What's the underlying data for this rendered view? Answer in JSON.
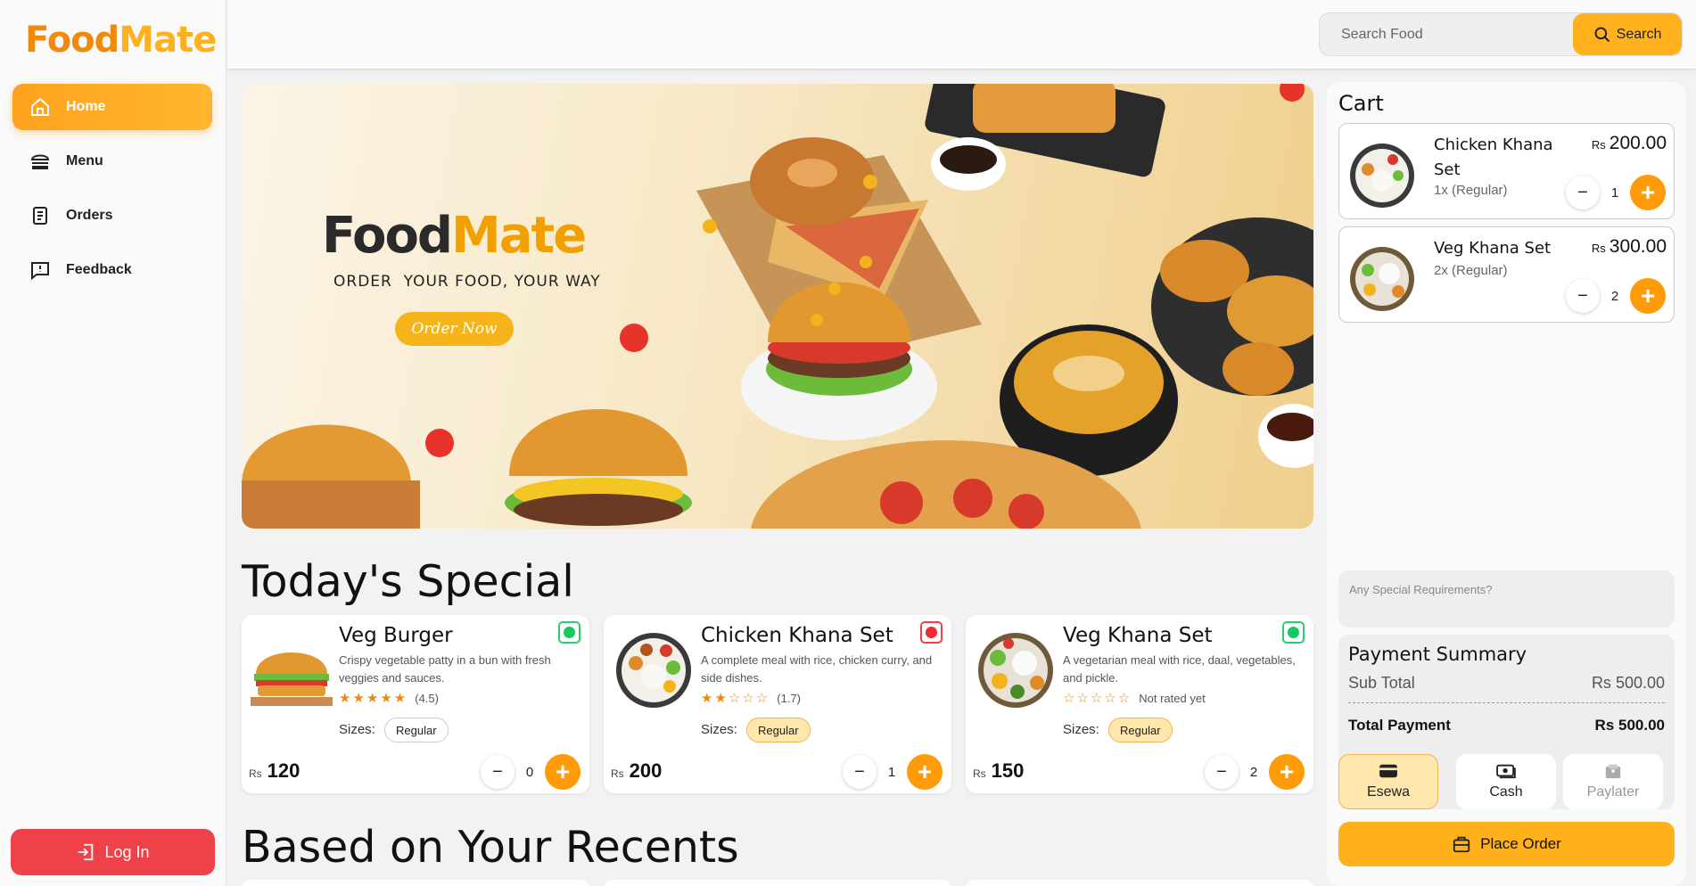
{
  "brand": {
    "part1": "Food",
    "part2": "Mate"
  },
  "nav": [
    {
      "label": "Home",
      "icon": "home-icon",
      "active": true
    },
    {
      "label": "Menu",
      "icon": "burger-icon"
    },
    {
      "label": "Orders",
      "icon": "document-icon"
    },
    {
      "label": "Feedback",
      "icon": "feedback-icon"
    }
  ],
  "login_label": "Log In",
  "search": {
    "placeholder": "Search Food",
    "button": "Search"
  },
  "banner": {
    "tagline": "ORDER  YOUR FOOD, YOUR WAY",
    "cta": "Order Now"
  },
  "sections": {
    "special": "Today's Special",
    "recents": "Based on Your Recents"
  },
  "specials": [
    {
      "name": "Veg Burger",
      "desc": "Crispy vegetable patty in a bun with fresh veggies and sauces.",
      "stars": "★★★★★",
      "rating": "(4.5)",
      "sizes_label": "Sizes:",
      "size": "Regular",
      "currency": "Rs",
      "price": "120",
      "qty": "0",
      "type": "veg"
    },
    {
      "name": "Chicken Khana Set",
      "desc": "A complete meal with rice, chicken curry, and side dishes.",
      "stars": "★★☆☆☆",
      "rating": "(1.7)",
      "sizes_label": "Sizes:",
      "size": "Regular",
      "currency": "Rs",
      "price": "200",
      "qty": "1",
      "type": "non-veg"
    },
    {
      "name": "Veg Khana Set",
      "desc": "A vegetarian meal with rice, daal, vegetables, and pickle.",
      "stars": "☆☆☆☆☆",
      "rating": "Not rated yet",
      "sizes_label": "Sizes:",
      "size": "Regular",
      "currency": "Rs",
      "price": "150",
      "qty": "2",
      "type": "veg"
    }
  ],
  "cart": {
    "title": "Cart",
    "items": [
      {
        "name": "Chicken Khana Set",
        "detail": "1x (Regular)",
        "currency": "Rs",
        "price": "200.00",
        "qty": "1"
      },
      {
        "name": "Veg Khana Set",
        "detail": "2x (Regular)",
        "currency": "Rs",
        "price": "300.00",
        "qty": "2"
      }
    ],
    "special_placeholder": "Any Special Requirements?",
    "summary": {
      "title": "Payment Summary",
      "subtotal_label": "Sub Total",
      "subtotal": "Rs 500.00",
      "total_label": "Total Payment",
      "total": "Rs 500.00"
    },
    "methods": [
      {
        "label": "Esewa",
        "selected": true
      },
      {
        "label": "Cash"
      },
      {
        "label": "Paylater",
        "disabled": true
      }
    ],
    "place_order": "Place Order"
  },
  "colors": {
    "accent": "#ffb11c",
    "orange": "#ff9a08",
    "login": "#ef4149"
  }
}
